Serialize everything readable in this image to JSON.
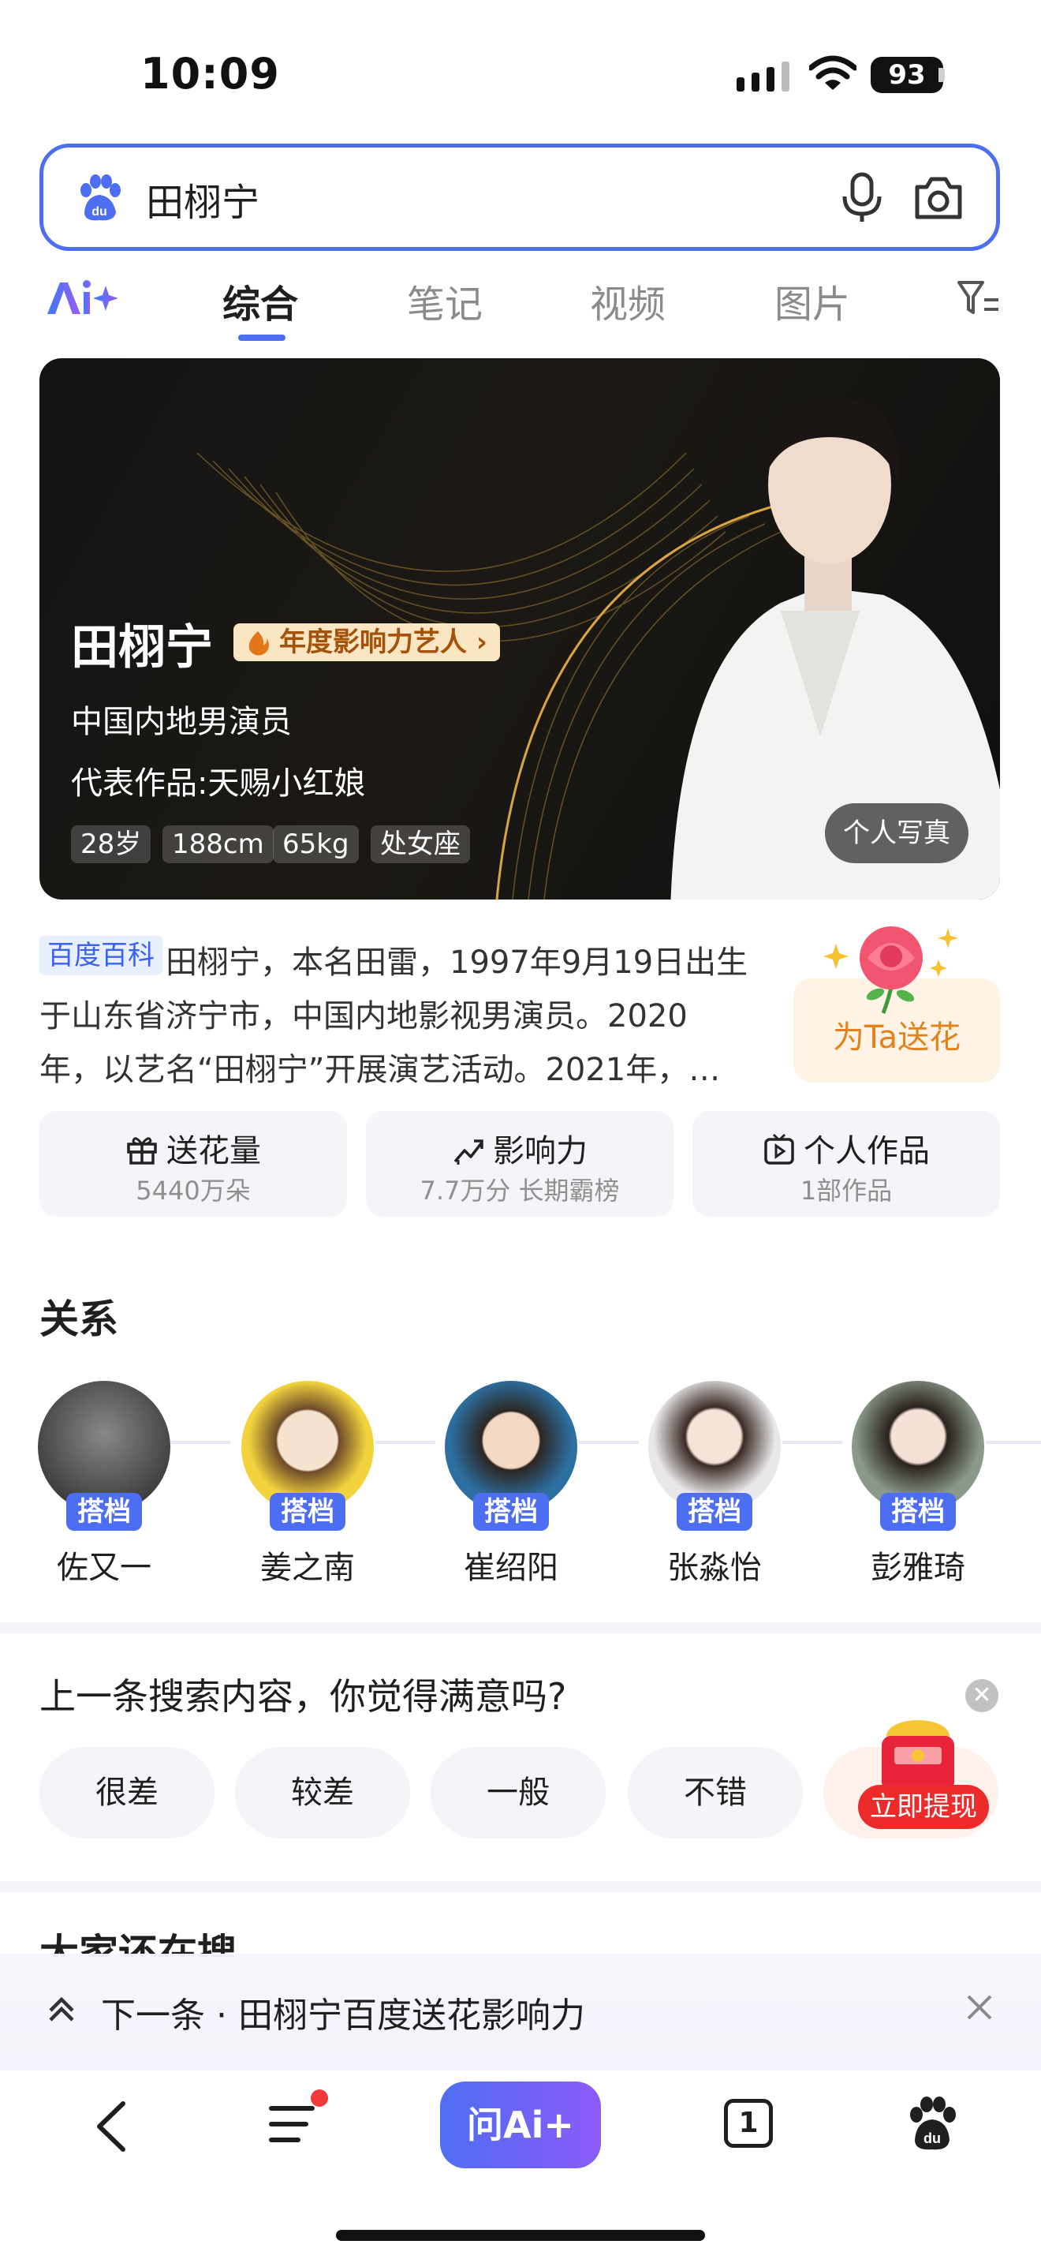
{
  "status": {
    "time": "10:09",
    "battery": "93"
  },
  "search": {
    "query": "田栩宁"
  },
  "tabs": {
    "items": [
      {
        "label": "综合",
        "active": true
      },
      {
        "label": "笔记"
      },
      {
        "label": "视频"
      },
      {
        "label": "图片"
      }
    ]
  },
  "hero": {
    "name": "田栩宁",
    "badge": "年度影响力艺人",
    "subtitle": "中国内地男演员",
    "works": "代表作品:天赐小红娘",
    "tags": [
      "28岁",
      "188cm",
      "65kg",
      "处女座"
    ],
    "photo_button": "个人写真"
  },
  "baike": {
    "tag": "百度百科",
    "text": "田栩宁，本名田雷，1997年9月19日出生于山东省济宁市，中国内地影视男演员。2020年，以艺名“田栩宁”开展演艺活动。2021年，…",
    "flower_button": "为Ta送花"
  },
  "stats": [
    {
      "title": "送花量",
      "sub": "5440万朵"
    },
    {
      "title": "影响力",
      "sub": "7.7万分  长期霸榜"
    },
    {
      "title": "个人作品",
      "sub": "1部作品"
    }
  ],
  "relations": {
    "title": "关系",
    "items": [
      {
        "name": "佐又一",
        "tag": "搭档"
      },
      {
        "name": "姜之南",
        "tag": "搭档"
      },
      {
        "name": "崔绍阳",
        "tag": "搭档"
      },
      {
        "name": "张淼怡",
        "tag": "搭档"
      },
      {
        "name": "彭雅琦",
        "tag": "搭档"
      }
    ]
  },
  "feedback": {
    "title": "上一条搜索内容，你觉得满意吗?",
    "options": [
      "很差",
      "较差",
      "一般",
      "不错"
    ],
    "withdraw": "立即提现"
  },
  "more": {
    "title": "大家还在搜"
  },
  "next": {
    "text": "下一条 · 田栩宁百度送花影响力"
  },
  "bottom_nav": {
    "ai_label": "问Ai+",
    "tabs_count": "1"
  },
  "colors": {
    "accent": "#4e6ef2",
    "orange": "#e5811b",
    "red": "#ee2b2b"
  }
}
